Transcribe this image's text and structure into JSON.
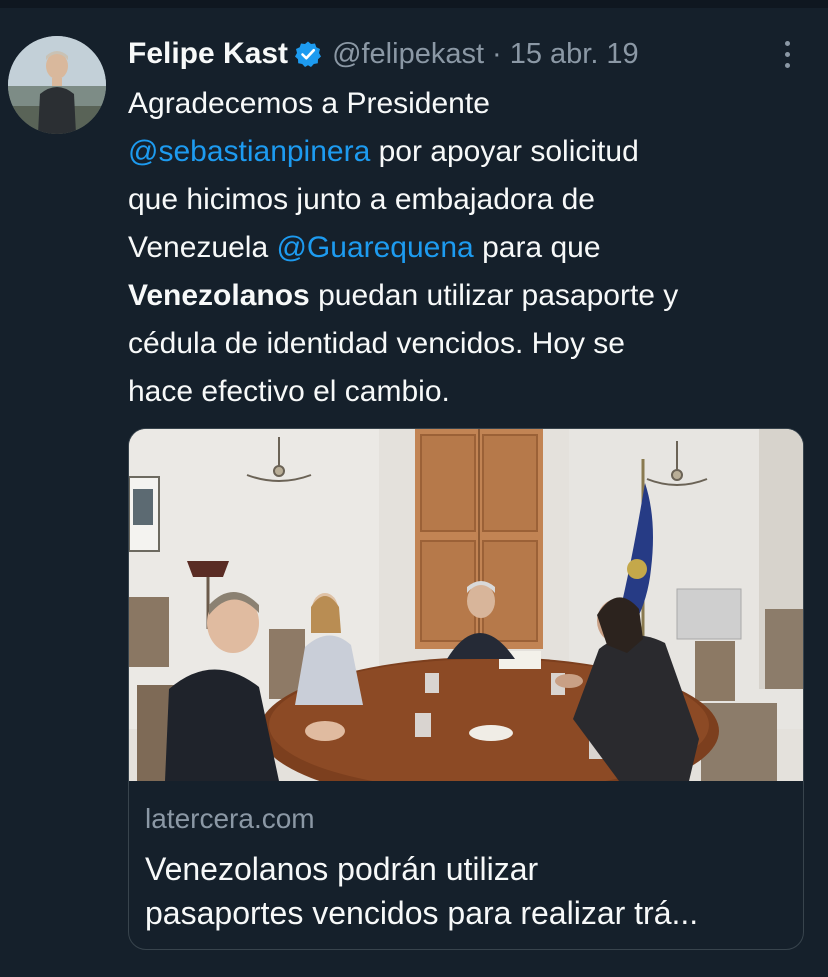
{
  "tweet": {
    "author_name": "Felipe Kast",
    "author_handle": "@felipekast",
    "separator": "·",
    "date": "15 abr. 19",
    "text": {
      "line1": "Agradecemos a Presidente",
      "mention1": "@sebastianpinera",
      "line2_rest": " por apoyar solicitud",
      "line3": "que hicimos junto a embajadora de",
      "line4_start": "Venezuela ",
      "mention2": "@Guarequena",
      "line4_end": " para que",
      "bold_word": "Venezolanos",
      "line5_rest": " puedan utilizar pasaporte y",
      "line6": "cédula de identidad vencidos. Hoy se",
      "line7": "hace efectivo el cambio."
    }
  },
  "card": {
    "domain": "latercera.com",
    "title_line1": "Venezolanos podrán utilizar",
    "title_line2": "pasaportes vencidos para realizar trá..."
  },
  "icons": {
    "verified": "verified-badge-icon",
    "more": "more-options-icon"
  },
  "colors": {
    "background": "#15202b",
    "mention": "#1d9bf0",
    "secondary_text": "#8b98a5",
    "border": "#38444d"
  }
}
